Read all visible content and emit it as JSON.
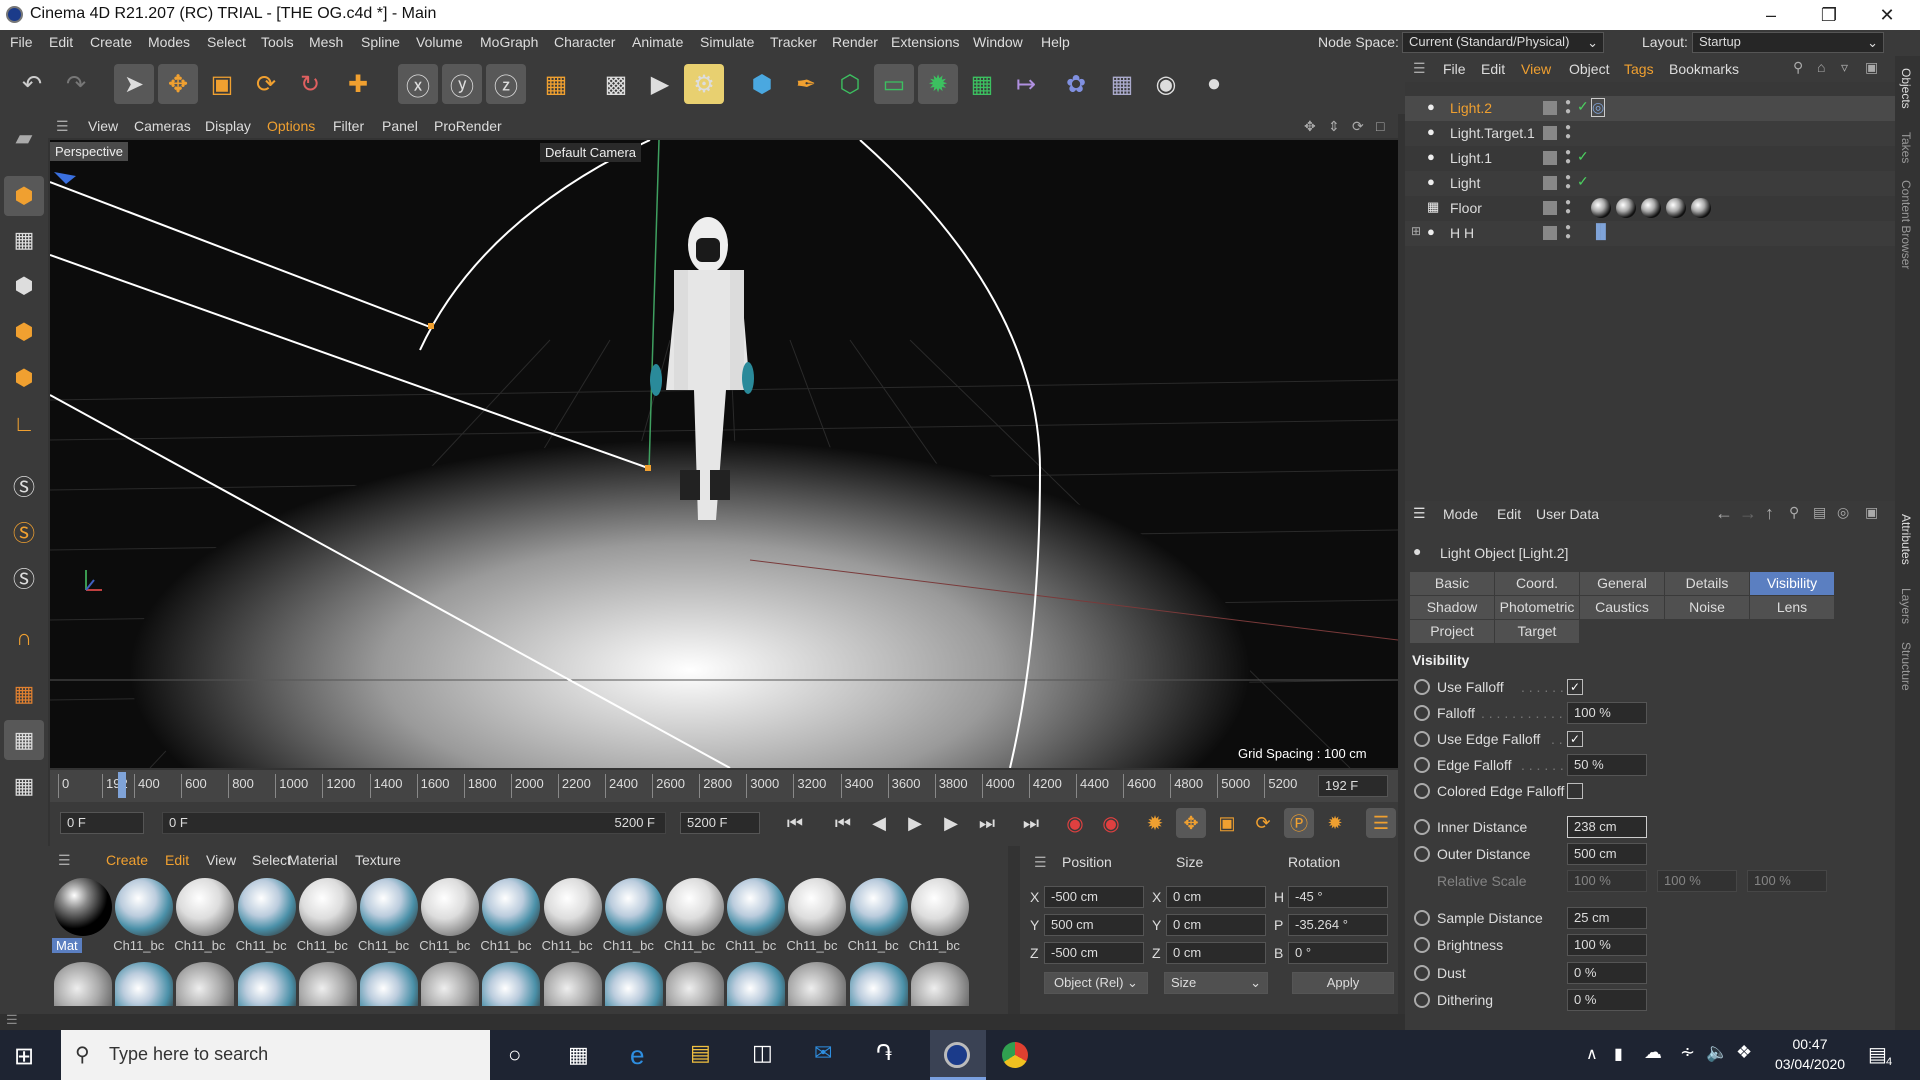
{
  "window": {
    "title": "Cinema 4D R21.207 (RC) TRIAL - [THE OG.c4d *] - Main"
  },
  "menu": [
    "File",
    "Edit",
    "Create",
    "Modes",
    "Select",
    "Tools",
    "Mesh",
    "Spline",
    "Volume",
    "MoGraph",
    "Character",
    "Animate",
    "Simulate",
    "Tracker",
    "Render",
    "Extensions",
    "Window",
    "Help"
  ],
  "node_space": {
    "label": "Node Space:",
    "value": "Current (Standard/Physical)"
  },
  "layout": {
    "label": "Layout:",
    "value": "Startup"
  },
  "viewport_menu": [
    "View",
    "Cameras",
    "Display",
    "Options",
    "Filter",
    "Panel",
    "ProRender"
  ],
  "viewport": {
    "name": "Perspective",
    "camera": "Default Camera",
    "grid": "Grid Spacing : 100 cm"
  },
  "timeline": {
    "ticks": [
      "0",
      "192",
      "400",
      "600",
      "800",
      "1000",
      "1200",
      "1400",
      "1600",
      "1800",
      "2000",
      "2200",
      "2400",
      "2600",
      "2800",
      "3000",
      "3200",
      "3400",
      "3600",
      "3800",
      "4000",
      "4200",
      "4400",
      "4600",
      "4800",
      "5000",
      "5200"
    ],
    "current": "192 F"
  },
  "range": {
    "start": "0 F",
    "min": "0 F",
    "max": "5200 F",
    "end": "5200 F"
  },
  "mat_menu": [
    "Create",
    "Edit",
    "View",
    "Select",
    "Material",
    "Texture"
  ],
  "materials": [
    "Mat",
    "Ch11_bc",
    "Ch11_bc",
    "Ch11_bc",
    "Ch11_bc",
    "Ch11_bc",
    "Ch11_bc",
    "Ch11_bc",
    "Ch11_bc",
    "Ch11_bc",
    "Ch11_bc",
    "Ch11_bc",
    "Ch11_bc",
    "Ch11_bc",
    "Ch11_bc"
  ],
  "coords": {
    "headers": [
      "Position",
      "Size",
      "Rotation"
    ],
    "rows": [
      {
        "a": "X",
        "pos": "-500 cm",
        "b": "X",
        "size": "0 cm",
        "c": "H",
        "rot": "-45 °"
      },
      {
        "a": "Y",
        "pos": "500 cm",
        "b": "Y",
        "size": "0 cm",
        "c": "P",
        "rot": "-35.264 °"
      },
      {
        "a": "Z",
        "pos": "-500 cm",
        "b": "Z",
        "size": "0 cm",
        "c": "B",
        "rot": "0 °"
      }
    ],
    "mode": "Object (Rel)",
    "size_mode": "Size",
    "apply": "Apply"
  },
  "obj_menu": [
    "File",
    "Edit",
    "View",
    "Object",
    "Tags",
    "Bookmarks"
  ],
  "objects": [
    {
      "name": "Light.2",
      "selected": true
    },
    {
      "name": "Light.Target.1",
      "selected": false
    },
    {
      "name": "Light.1",
      "selected": false
    },
    {
      "name": "Light",
      "selected": false
    },
    {
      "name": "Floor",
      "selected": false
    },
    {
      "name": "H H",
      "selected": false
    }
  ],
  "attr_menu": [
    "Mode",
    "Edit",
    "User Data"
  ],
  "attr_title": "Light Object [Light.2]",
  "tabs": [
    "Basic",
    "Coord.",
    "General",
    "Details",
    "Visibility",
    "Shadow",
    "Photometric",
    "Caustics",
    "Noise",
    "Lens",
    "Project",
    "Target"
  ],
  "section": "Visibility",
  "attrs": {
    "use_falloff": "Use Falloff",
    "falloff": "Falloff",
    "falloff_v": "100 %",
    "use_edge": "Use Edge Falloff",
    "edge": "Edge Falloff",
    "edge_v": "50 %",
    "colored": "Colored Edge Falloff",
    "inner": "Inner Distance",
    "inner_v": "238 cm",
    "outer": "Outer Distance",
    "outer_v": "500 cm",
    "rel": "Relative Scale",
    "rel_v": [
      "100 %",
      "100 %",
      "100 %"
    ],
    "sample": "Sample Distance",
    "sample_v": "25 cm",
    "bright": "Brightness",
    "bright_v": "100 %",
    "dust": "Dust",
    "dust_v": "0 %",
    "dither": "Dithering",
    "dither_v": "0 %"
  },
  "right_strip": [
    "Objects",
    "Takes",
    "Content Browser",
    "Attributes",
    "Layers",
    "Structure"
  ],
  "taskbar": {
    "search": "Type here to search",
    "time": "00:47",
    "date": "03/04/2020",
    "notif": "4"
  }
}
